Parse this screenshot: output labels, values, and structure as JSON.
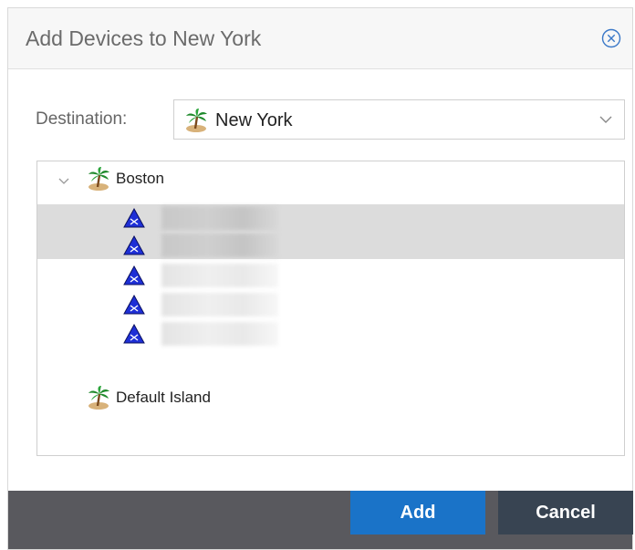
{
  "dialog": {
    "title": "Add Devices to New York",
    "close_icon": "close-circle-icon"
  },
  "destination": {
    "label": "Destination:",
    "value": "New York",
    "icon": "palm-island-icon",
    "chevron": "chevron-down-icon"
  },
  "tree": {
    "nodes": [
      {
        "label": "Boston",
        "icon": "palm-island-icon",
        "expanded": true
      },
      {
        "label": "",
        "icon": "device-triangle-icon",
        "selected": true,
        "note": ""
      },
      {
        "label": "",
        "icon": "device-triangle-icon",
        "selected": true
      },
      {
        "label": "",
        "icon": "device-triangle-icon",
        "selected": false
      },
      {
        "label": "",
        "icon": "device-triangle-icon",
        "selected": false
      },
      {
        "label": "",
        "icon": "device-triangle-icon",
        "selected": false
      },
      {
        "label": "Default Island",
        "icon": "palm-island-icon"
      }
    ]
  },
  "footer": {
    "add_label": "Add",
    "cancel_label": "Cancel"
  },
  "colors": {
    "primary_button": "#1a73c8",
    "secondary_button": "#384452",
    "footer_bg": "#59595e",
    "selection_bg": "#dcdcdc"
  }
}
